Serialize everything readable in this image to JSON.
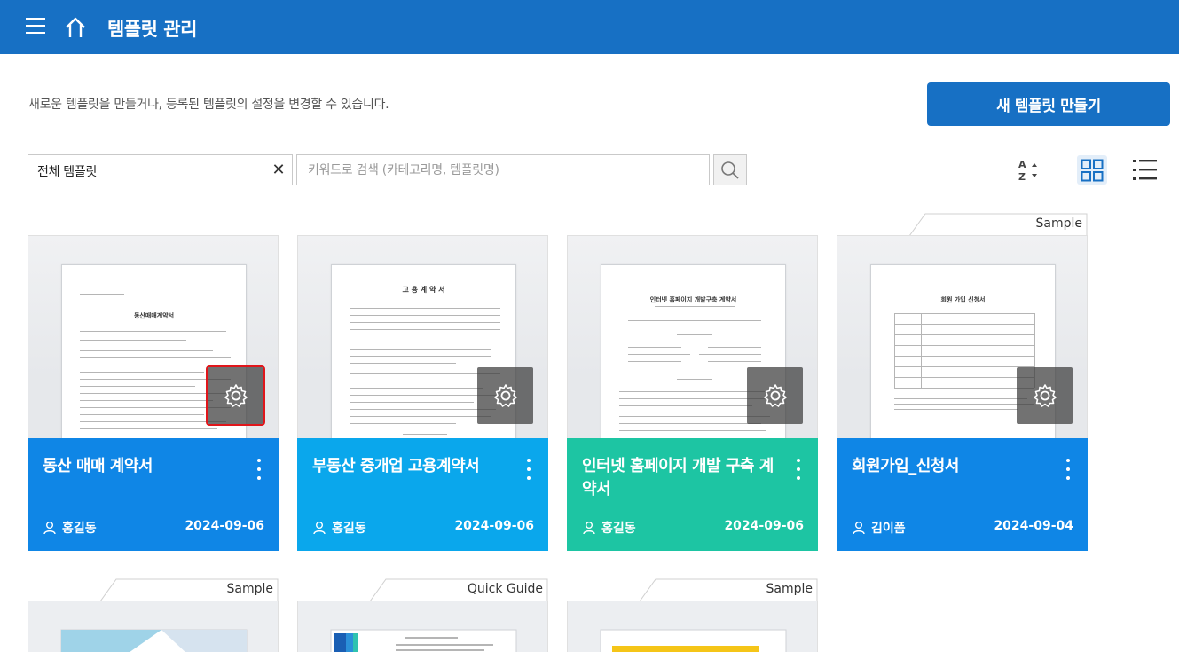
{
  "header": {
    "title": "템플릿 관리",
    "bg_color": "#1770c4"
  },
  "description": "새로운 템플릿을 만들거나, 등록된 템플릿의 설정을 변경할 수 있습니다.",
  "new_button_label": "새 템플릿 만들기",
  "filter": {
    "selected": "전체 템플릿",
    "clear_label": "✕"
  },
  "search": {
    "placeholder": "키워드로 검색 (카테고리명, 템플릿명)",
    "value": ""
  },
  "view": {
    "sort_icon": "sort-az-icon",
    "active_mode": "grid"
  },
  "templates": [
    {
      "name": "동산 매매 계약서",
      "author": "홍길동",
      "date": "2024-09-06",
      "color": "#0f86e6",
      "badge": "",
      "doc_title": "동산매매계약서"
    },
    {
      "name": "부동산 중개업 고용계약서",
      "author": "홍길동",
      "date": "2024-09-06",
      "color": "#0aa7ec",
      "badge": "",
      "doc_title": "고 용 계 약 서"
    },
    {
      "name": "인터넷 홈페이지 개발 구축 계약서",
      "author": "홍길동",
      "date": "2024-09-06",
      "color": "#1dc5a3",
      "badge": "",
      "doc_title": "인터넷 홈페이지 개발구축 계약서"
    },
    {
      "name": "회원가입_신청서",
      "author": "김이폼",
      "date": "2024-09-04",
      "color": "#0f86e6",
      "badge": "Sample",
      "doc_title": "회원 가입 신청서"
    }
  ],
  "bottom_badges": [
    "Sample",
    "Quick Guide",
    "Sample"
  ]
}
